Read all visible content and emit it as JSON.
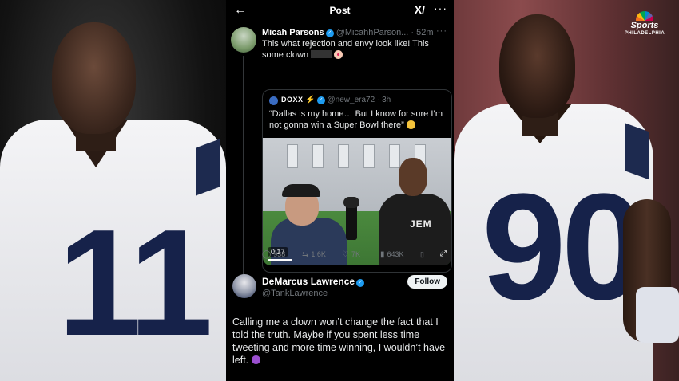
{
  "phone": {
    "title": "Post",
    "tweet1": {
      "name": "Micah Parsons",
      "handle": "@MicahhParson...",
      "time": "52m",
      "text_a": "This what rejection and envy look like! This some clown"
    },
    "quote": {
      "name": "DOXX",
      "handle": "@new_era72",
      "time": "3h",
      "text": "“Dallas is my home… But I know for sure I’m not gonna win a Super Bowl there”",
      "video_time": "0:17",
      "hood_text": "JEM"
    },
    "actions": {
      "replies": "938",
      "reposts": "1.6K",
      "likes": "7K",
      "views": "643K"
    },
    "tweet2": {
      "name": "DeMarcus Lawrence",
      "handle": "@TankLawrence",
      "follow_label": "Follow",
      "text": "Calling me a clown won’t change the fact that I told the truth. Maybe if you spent less time tweeting and more time winning, I wouldn’t have left."
    }
  },
  "left_player": {
    "jersey_number": "11"
  },
  "right_player": {
    "jersey_number": "90"
  },
  "logo": {
    "line1": "Sports",
    "line2": "PHILADELPHIA"
  },
  "icons": [
    "back-arrow-icon",
    "grok-icon",
    "more-icon",
    "verified-icon",
    "reply-icon",
    "repost-icon",
    "like-icon",
    "views-icon",
    "bookmark-icon",
    "share-icon",
    "expand-icon",
    "nbc-peacock-icon"
  ],
  "colors": {
    "accent": "#1d9bf0",
    "navy": "#16224a",
    "bg": "#000000"
  }
}
